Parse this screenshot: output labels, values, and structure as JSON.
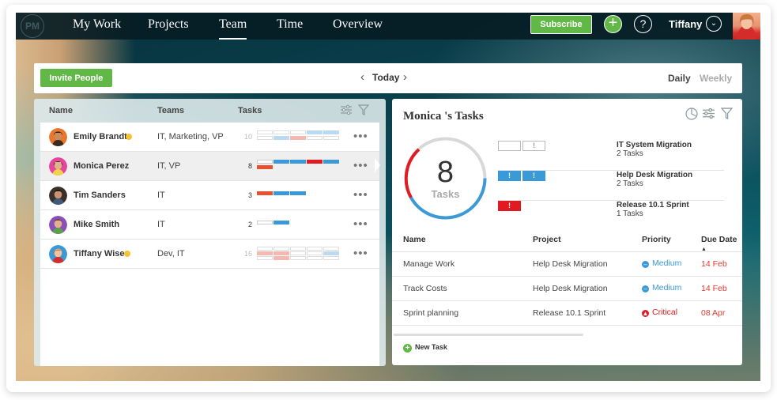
{
  "nav": {
    "logo": "PM",
    "items": [
      "My Work",
      "Projects",
      "Team",
      "Time",
      "Overview"
    ],
    "active": "Team",
    "subscribe_label": "Subscribe",
    "user_name": "Tiffany"
  },
  "toolbar": {
    "invite_label": "Invite People",
    "today_label": "Today",
    "daily_label": "Daily",
    "weekly_label": "Weekly",
    "active_view": "Daily"
  },
  "team": {
    "headers": {
      "name": "Name",
      "teams": "Teams",
      "tasks": "Tasks"
    },
    "members": [
      {
        "name": "Emily Brandt",
        "teams": "IT, Marketing, VP",
        "tasks": "10",
        "online": true,
        "selected": false
      },
      {
        "name": "Monica Perez",
        "teams": "IT, VP",
        "tasks": "8",
        "online": false,
        "selected": true
      },
      {
        "name": "Tim Sanders",
        "teams": "IT",
        "tasks": "3",
        "online": false,
        "selected": false
      },
      {
        "name": "Mike Smith",
        "teams": "IT",
        "tasks": "2",
        "online": false,
        "selected": false
      },
      {
        "name": "Tiffany Wise",
        "teams": "Dev, IT",
        "tasks": "16",
        "online": true,
        "selected": false
      }
    ],
    "more_label": "•••"
  },
  "tasks_panel": {
    "title": "Monica 's Tasks",
    "total": "8",
    "total_label": "Tasks",
    "projects": [
      {
        "name": "IT System Migration",
        "count": "2 Tasks"
      },
      {
        "name": "Help Desk Migration",
        "count": "2 Tasks"
      },
      {
        "name": "Release 10.1 Sprint",
        "count": "1 Tasks"
      }
    ],
    "columns": {
      "name": "Name",
      "project": "Project",
      "priority": "Priority",
      "due": "Due Date"
    },
    "rows": [
      {
        "name": "Manage Work",
        "project": "Help Desk Migration",
        "priority": "Medium",
        "due": "14 Feb"
      },
      {
        "name": "Track Costs",
        "project": "Help Desk Migration",
        "priority": "Medium",
        "due": "14 Feb"
      },
      {
        "name": "Sprint planning",
        "project": "Release 10.1 Sprint",
        "priority": "Critical",
        "due": "08 Apr"
      }
    ],
    "new_task_label": "New Task"
  },
  "colors": {
    "green": "#62b847",
    "blue": "#3a9ad8",
    "red": "#e11b22",
    "due_red": "#e0392f"
  }
}
